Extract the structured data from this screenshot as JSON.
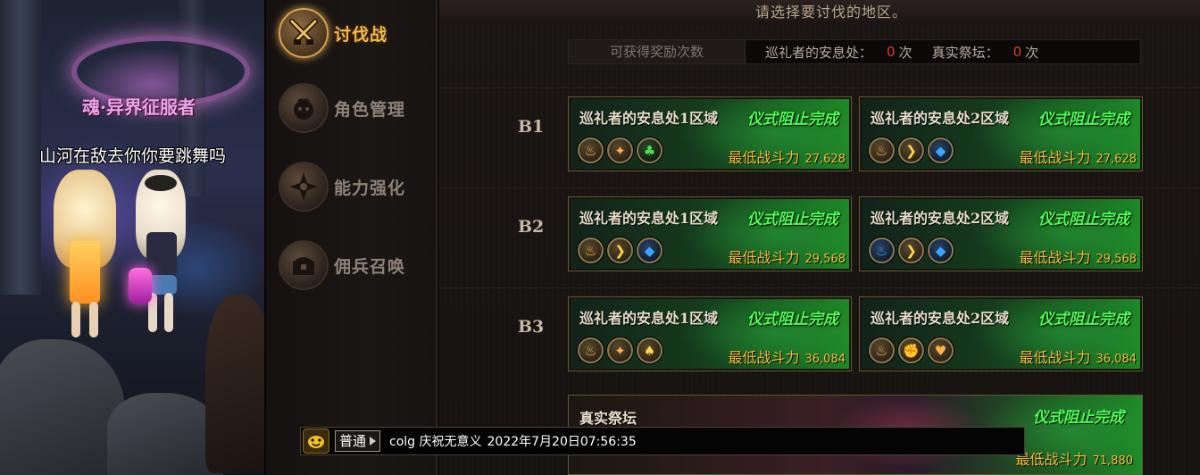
{
  "scene": {
    "guild_title": "魂·异界征服者",
    "player_name": "山河在敌去你你要跳舞吗"
  },
  "menu": {
    "items": [
      {
        "label": "讨伐战",
        "icon": "crossed-swords-icon",
        "active": true
      },
      {
        "label": "角色管理",
        "icon": "character-face-icon",
        "active": false
      },
      {
        "label": "能力强化",
        "icon": "shuriken-star-icon",
        "active": false
      },
      {
        "label": "佣兵召唤",
        "icon": "treasure-chest-icon",
        "active": false
      }
    ]
  },
  "main": {
    "prompt": "请选择要讨伐的地区。",
    "rewards": {
      "label": "可获得奖励次数",
      "pilgrim_label": "巡礼者的安息处：",
      "pilgrim_count": "0",
      "altar_label": "真实祭坛：",
      "altar_count": "0",
      "unit": "次"
    },
    "floors": [
      {
        "label": "B1",
        "zones": [
          {
            "name": "巡礼者的安息处1区域",
            "status": "仪式阻止完成",
            "power_label": "最低战斗力",
            "power": "27,628",
            "icons": [
              "fire-rune-icon",
              "torch-icon",
              "club-suit-icon"
            ]
          },
          {
            "name": "巡礼者的安息处2区域",
            "status": "仪式阻止完成",
            "power_label": "最低战斗力",
            "power": "27,628",
            "icons": [
              "fire-rune-icon",
              "chevron-rune-icon",
              "diamond-rune-icon"
            ]
          }
        ]
      },
      {
        "label": "B2",
        "zones": [
          {
            "name": "巡礼者的安息处1区域",
            "status": "仪式阻止完成",
            "power_label": "最低战斗力",
            "power": "29,568",
            "icons": [
              "fire-rune-icon",
              "chevron-rune-icon",
              "diamond-rune-icon"
            ]
          },
          {
            "name": "巡礼者的安息处2区域",
            "status": "仪式阻止完成",
            "power_label": "最低战斗力",
            "power": "29,568",
            "icons": [
              "water-rune-icon",
              "chevron-rune-icon",
              "diamond-rune-icon"
            ]
          }
        ]
      },
      {
        "label": "B3",
        "zones": [
          {
            "name": "巡礼者的安息处1区域",
            "status": "仪式阻止完成",
            "power_label": "最低战斗力",
            "power": "36,084",
            "icons": [
              "fire-rune-icon",
              "torch-icon",
              "spade-suit-icon"
            ]
          },
          {
            "name": "巡礼者的安息处2区域",
            "status": "仪式阻止完成",
            "power_label": "最低战斗力",
            "power": "36,084",
            "icons": [
              "fire-rune-icon",
              "fist-icon",
              "heart-suit-icon"
            ]
          }
        ]
      }
    ],
    "altar": {
      "name": "真实祭坛",
      "status": "仪式阻止完成",
      "power_label": "最低战斗力",
      "power": "71,880"
    }
  },
  "chat": {
    "channel": "普通",
    "message": "colg 庆祝无意义",
    "timestamp": "2022年7月20日07:56:35"
  }
}
